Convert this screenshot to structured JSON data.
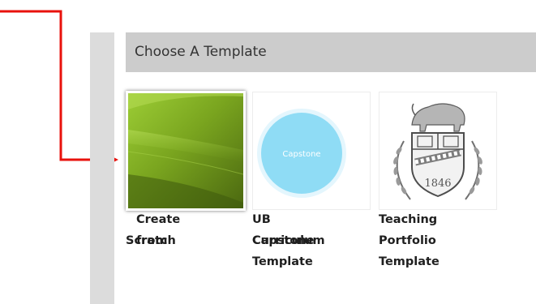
{
  "panel": {
    "title": "Choose A Template"
  },
  "templates": [
    {
      "label_line1": "Create from",
      "label_line2": "Scratch",
      "thumbnail": "green-abstract-thumbnail",
      "selected": true
    },
    {
      "label_line1": "UB Curriculum",
      "label_line2": "Capstone",
      "label_line3": "Template",
      "thumbnail": "capstone-circle-thumbnail",
      "thumbnail_text": "Capstone",
      "selected": false
    },
    {
      "label_line1": "Teaching",
      "label_line2": "Portfolio",
      "label_line3": "Template",
      "thumbnail": "ub-seal-thumbnail",
      "thumbnail_text": "1846",
      "selected": false
    }
  ],
  "colors": {
    "arrow": "#e8120c",
    "header_bg": "#cccccc",
    "side_bar": "#dcdcdc",
    "capstone_circle": "#8fdcf5",
    "green_dark": "#4e6b12",
    "green_light": "#8fc22a"
  }
}
